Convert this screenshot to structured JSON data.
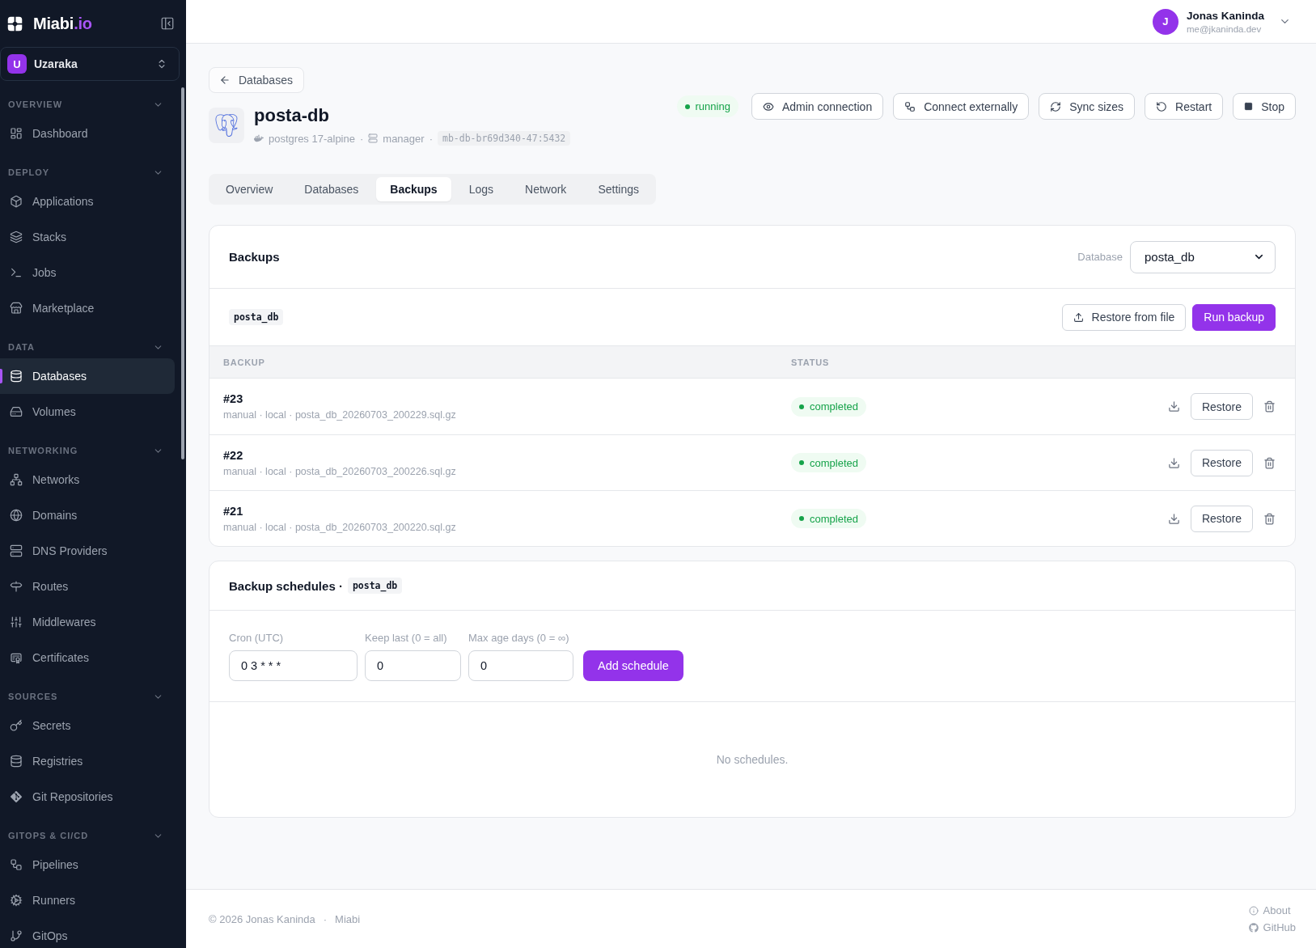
{
  "sidebar": {
    "brand": {
      "name": "Miabi",
      "suffix": ".io"
    },
    "org": {
      "initial": "U",
      "name": "Uzaraka"
    },
    "sections": [
      {
        "title": "OVERVIEW",
        "expanded": true,
        "items": [
          {
            "label": "Dashboard",
            "selected": false
          }
        ]
      },
      {
        "title": "DEPLOY",
        "expanded": true,
        "items": [
          {
            "label": "Applications",
            "selected": false
          },
          {
            "label": "Stacks",
            "selected": false
          },
          {
            "label": "Jobs",
            "selected": false
          },
          {
            "label": "Marketplace",
            "selected": false
          }
        ]
      },
      {
        "title": "DATA",
        "expanded": true,
        "items": [
          {
            "label": "Databases",
            "selected": true
          },
          {
            "label": "Volumes",
            "selected": false
          }
        ]
      },
      {
        "title": "NETWORKING",
        "expanded": true,
        "items": [
          {
            "label": "Networks",
            "selected": false
          },
          {
            "label": "Domains",
            "selected": false
          },
          {
            "label": "DNS Providers",
            "selected": false
          },
          {
            "label": "Routes",
            "selected": false
          },
          {
            "label": "Middlewares",
            "selected": false
          },
          {
            "label": "Certificates",
            "selected": false
          }
        ]
      },
      {
        "title": "SOURCES",
        "expanded": true,
        "items": [
          {
            "label": "Secrets",
            "selected": false
          },
          {
            "label": "Registries",
            "selected": false
          },
          {
            "label": "Git Repositories",
            "selected": false
          }
        ]
      },
      {
        "title": "GITOPS & CI/CD",
        "expanded": true,
        "items": [
          {
            "label": "Pipelines",
            "selected": false
          },
          {
            "label": "Runners",
            "selected": false
          },
          {
            "label": "GitOps",
            "selected": false
          }
        ]
      }
    ]
  },
  "user": {
    "initial": "J",
    "name": "Jonas Kaninda",
    "email": "me@jkaninda.dev"
  },
  "page": {
    "back": "Databases",
    "title": "posta-db",
    "meta": {
      "separator": "·",
      "image": "postgres 17-alpine",
      "node": "manager",
      "address": "mb-db-br69d340-47:5432"
    },
    "status": "running",
    "actions": [
      {
        "label": "Admin connection"
      },
      {
        "label": "Connect externally"
      },
      {
        "label": "Sync sizes"
      },
      {
        "label": "Restart"
      },
      {
        "label": "Stop"
      }
    ]
  },
  "tabs": [
    {
      "label": "Overview",
      "selected": false
    },
    {
      "label": "Databases",
      "selected": false
    },
    {
      "label": "Backups",
      "selected": true
    },
    {
      "label": "Logs",
      "selected": false
    },
    {
      "label": "Network",
      "selected": false
    },
    {
      "label": "Settings",
      "selected": false
    }
  ],
  "backups": {
    "title": "Backups",
    "database_label": "Database",
    "database": "posta_db",
    "tag": "posta_db",
    "buttons": [
      {
        "label": "Restore from file",
        "kind": "outline"
      },
      {
        "label": "Run backup",
        "kind": "primary"
      }
    ],
    "columns": [
      "BACKUP",
      "STATUS"
    ],
    "rows": [
      {
        "id": "#23",
        "details": "manual · local · posta_db_20260703_200229.sql.gz",
        "status": "completed",
        "action": "Restore"
      },
      {
        "id": "#22",
        "details": "manual · local · posta_db_20260703_200226.sql.gz",
        "status": "completed",
        "action": "Restore"
      },
      {
        "id": "#21",
        "details": "manual · local · posta_db_20260703_200220.sql.gz",
        "status": "completed",
        "action": "Restore"
      }
    ]
  },
  "schedules": {
    "title": "Backup schedules ·",
    "tag": "posta_db",
    "fields": [
      {
        "label": "Cron (UTC)",
        "value": "0 3 * * *"
      },
      {
        "label": "Keep last (0 = all)",
        "value": "0"
      },
      {
        "label": "Max age days (0 = ∞)",
        "value": "0"
      }
    ],
    "button": "Add schedule",
    "empty": "No schedules."
  },
  "footer": {
    "copyright": "© 2026 Jonas Kaninda",
    "separator": "·",
    "brand": "Miabi",
    "links": [
      "About",
      "GitHub"
    ]
  }
}
